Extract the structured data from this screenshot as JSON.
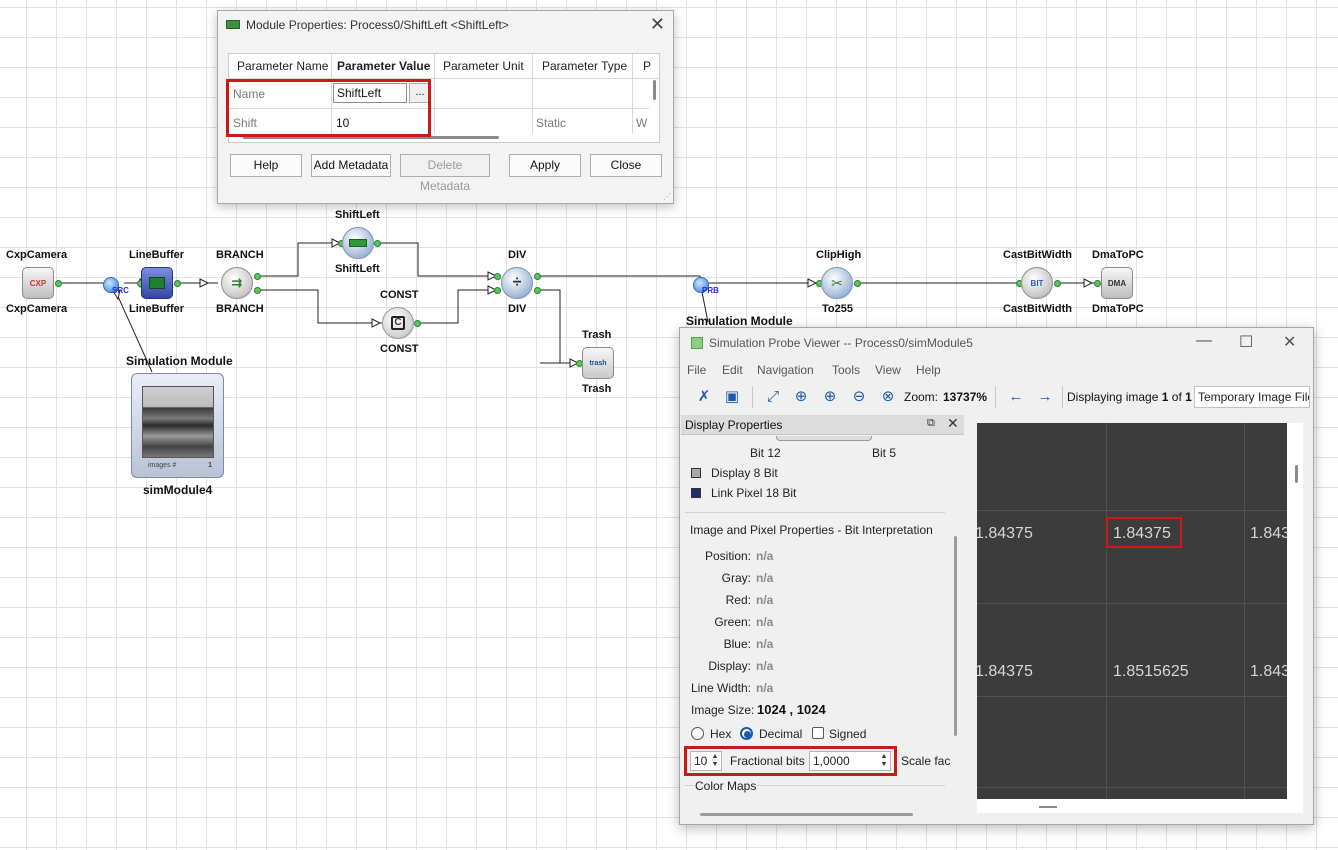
{
  "canvas": {
    "nodes": {
      "cxp_camera": {
        "top_label": "CxpCamera",
        "bottom_label": "CxpCamera",
        "glyph": "CXP"
      },
      "line_buffer": {
        "top_label": "LineBuffer",
        "bottom_label": "LineBuffer"
      },
      "branch": {
        "top_label": "BRANCH",
        "bottom_label": "BRANCH"
      },
      "shift_left": {
        "top_label": "ShiftLeft",
        "bottom_label": "ShiftLeft"
      },
      "const": {
        "top_label": "CONST",
        "bottom_label": "CONST",
        "glyph": "C"
      },
      "div": {
        "top_label": "DIV",
        "bottom_label": "DIV",
        "glyph": "÷"
      },
      "trash": {
        "top_label": "Trash",
        "bottom_label": "Trash",
        "glyph": "trash"
      },
      "clip_high": {
        "top_label": "ClipHigh",
        "bottom_label": "To255"
      },
      "cast_bit_width": {
        "top_label": "CastBitWidth",
        "bottom_label": "CastBitWidth",
        "glyph": "BIT"
      },
      "dma_to_pc": {
        "top_label": "DmaToPC",
        "bottom_label": "DmaToPC",
        "glyph": "DMA"
      }
    },
    "src_tag": "SRC",
    "prb_tag": "PRB",
    "sim_module_label_left": "Simulation Module",
    "sim_module_label_right": "Simulation Module",
    "sim_module_name": "simModule4",
    "sim_images_label": "images #",
    "sim_images_count": "1"
  },
  "module_dialog": {
    "title": "Module Properties: Process0/ShiftLeft <ShiftLeft>",
    "columns": [
      "Parameter Name",
      "Parameter Value",
      "Parameter Unit",
      "Parameter Type",
      "P"
    ],
    "rows": [
      {
        "name": "Name",
        "value": "ShiftLeft",
        "unit": "",
        "type": "",
        "extra": "",
        "browse": "..."
      },
      {
        "name": "Shift",
        "value": "10",
        "unit": "",
        "type": "Static",
        "extra": "W"
      }
    ],
    "buttons": {
      "help": "Help",
      "add_metadata": "Add Metadata",
      "delete_metadata": "Delete Metadata",
      "apply": "Apply",
      "close": "Close"
    }
  },
  "viewer": {
    "title": "Simulation Probe Viewer -- Process0/simModule5",
    "menu": [
      "File",
      "Edit",
      "Navigation",
      "Tools",
      "View",
      "Help"
    ],
    "zoom_label": "Zoom:",
    "zoom_value": "13737%",
    "displaying_prefix": "Displaying image",
    "image_index": "1",
    "of_label": "of",
    "image_total": "1",
    "source_field": "Temporary Image File",
    "display_panel": {
      "title": "Display Properties",
      "bit_left": "Bit 12",
      "bit_right": "Bit 5",
      "legend": [
        {
          "label": "Display 8 Bit",
          "color": "#a9a9a9"
        },
        {
          "label": "Link Pixel 18 Bit",
          "color": "#1f2f6b"
        }
      ],
      "section_title": "Image and Pixel Properties - Bit Interpretation",
      "props": [
        {
          "label": "Position:",
          "value": "n/a"
        },
        {
          "label": "Gray:",
          "value": "n/a"
        },
        {
          "label": "Red:",
          "value": "n/a"
        },
        {
          "label": "Green:",
          "value": "n/a"
        },
        {
          "label": "Blue:",
          "value": "n/a"
        },
        {
          "label": "Display:",
          "value": "n/a"
        },
        {
          "label": "Line Width:",
          "value": "n/a"
        }
      ],
      "image_size_label": "Image Size:",
      "image_size_value": "1024 , 1024",
      "radio_hex": "Hex",
      "radio_decimal": "Decimal",
      "check_signed": "Signed",
      "fractional_value": "10",
      "fractional_label": "Fractional bits",
      "scale_value": "1,0000",
      "scale_label": "Scale fac",
      "color_maps": "Color Maps"
    },
    "pixels": [
      {
        "text": "1.84375"
      },
      {
        "text": "1.84375"
      },
      {
        "text": "1.843"
      },
      {
        "text": "1.84375"
      },
      {
        "text": "1.8515625"
      },
      {
        "text": "1.843"
      }
    ]
  }
}
